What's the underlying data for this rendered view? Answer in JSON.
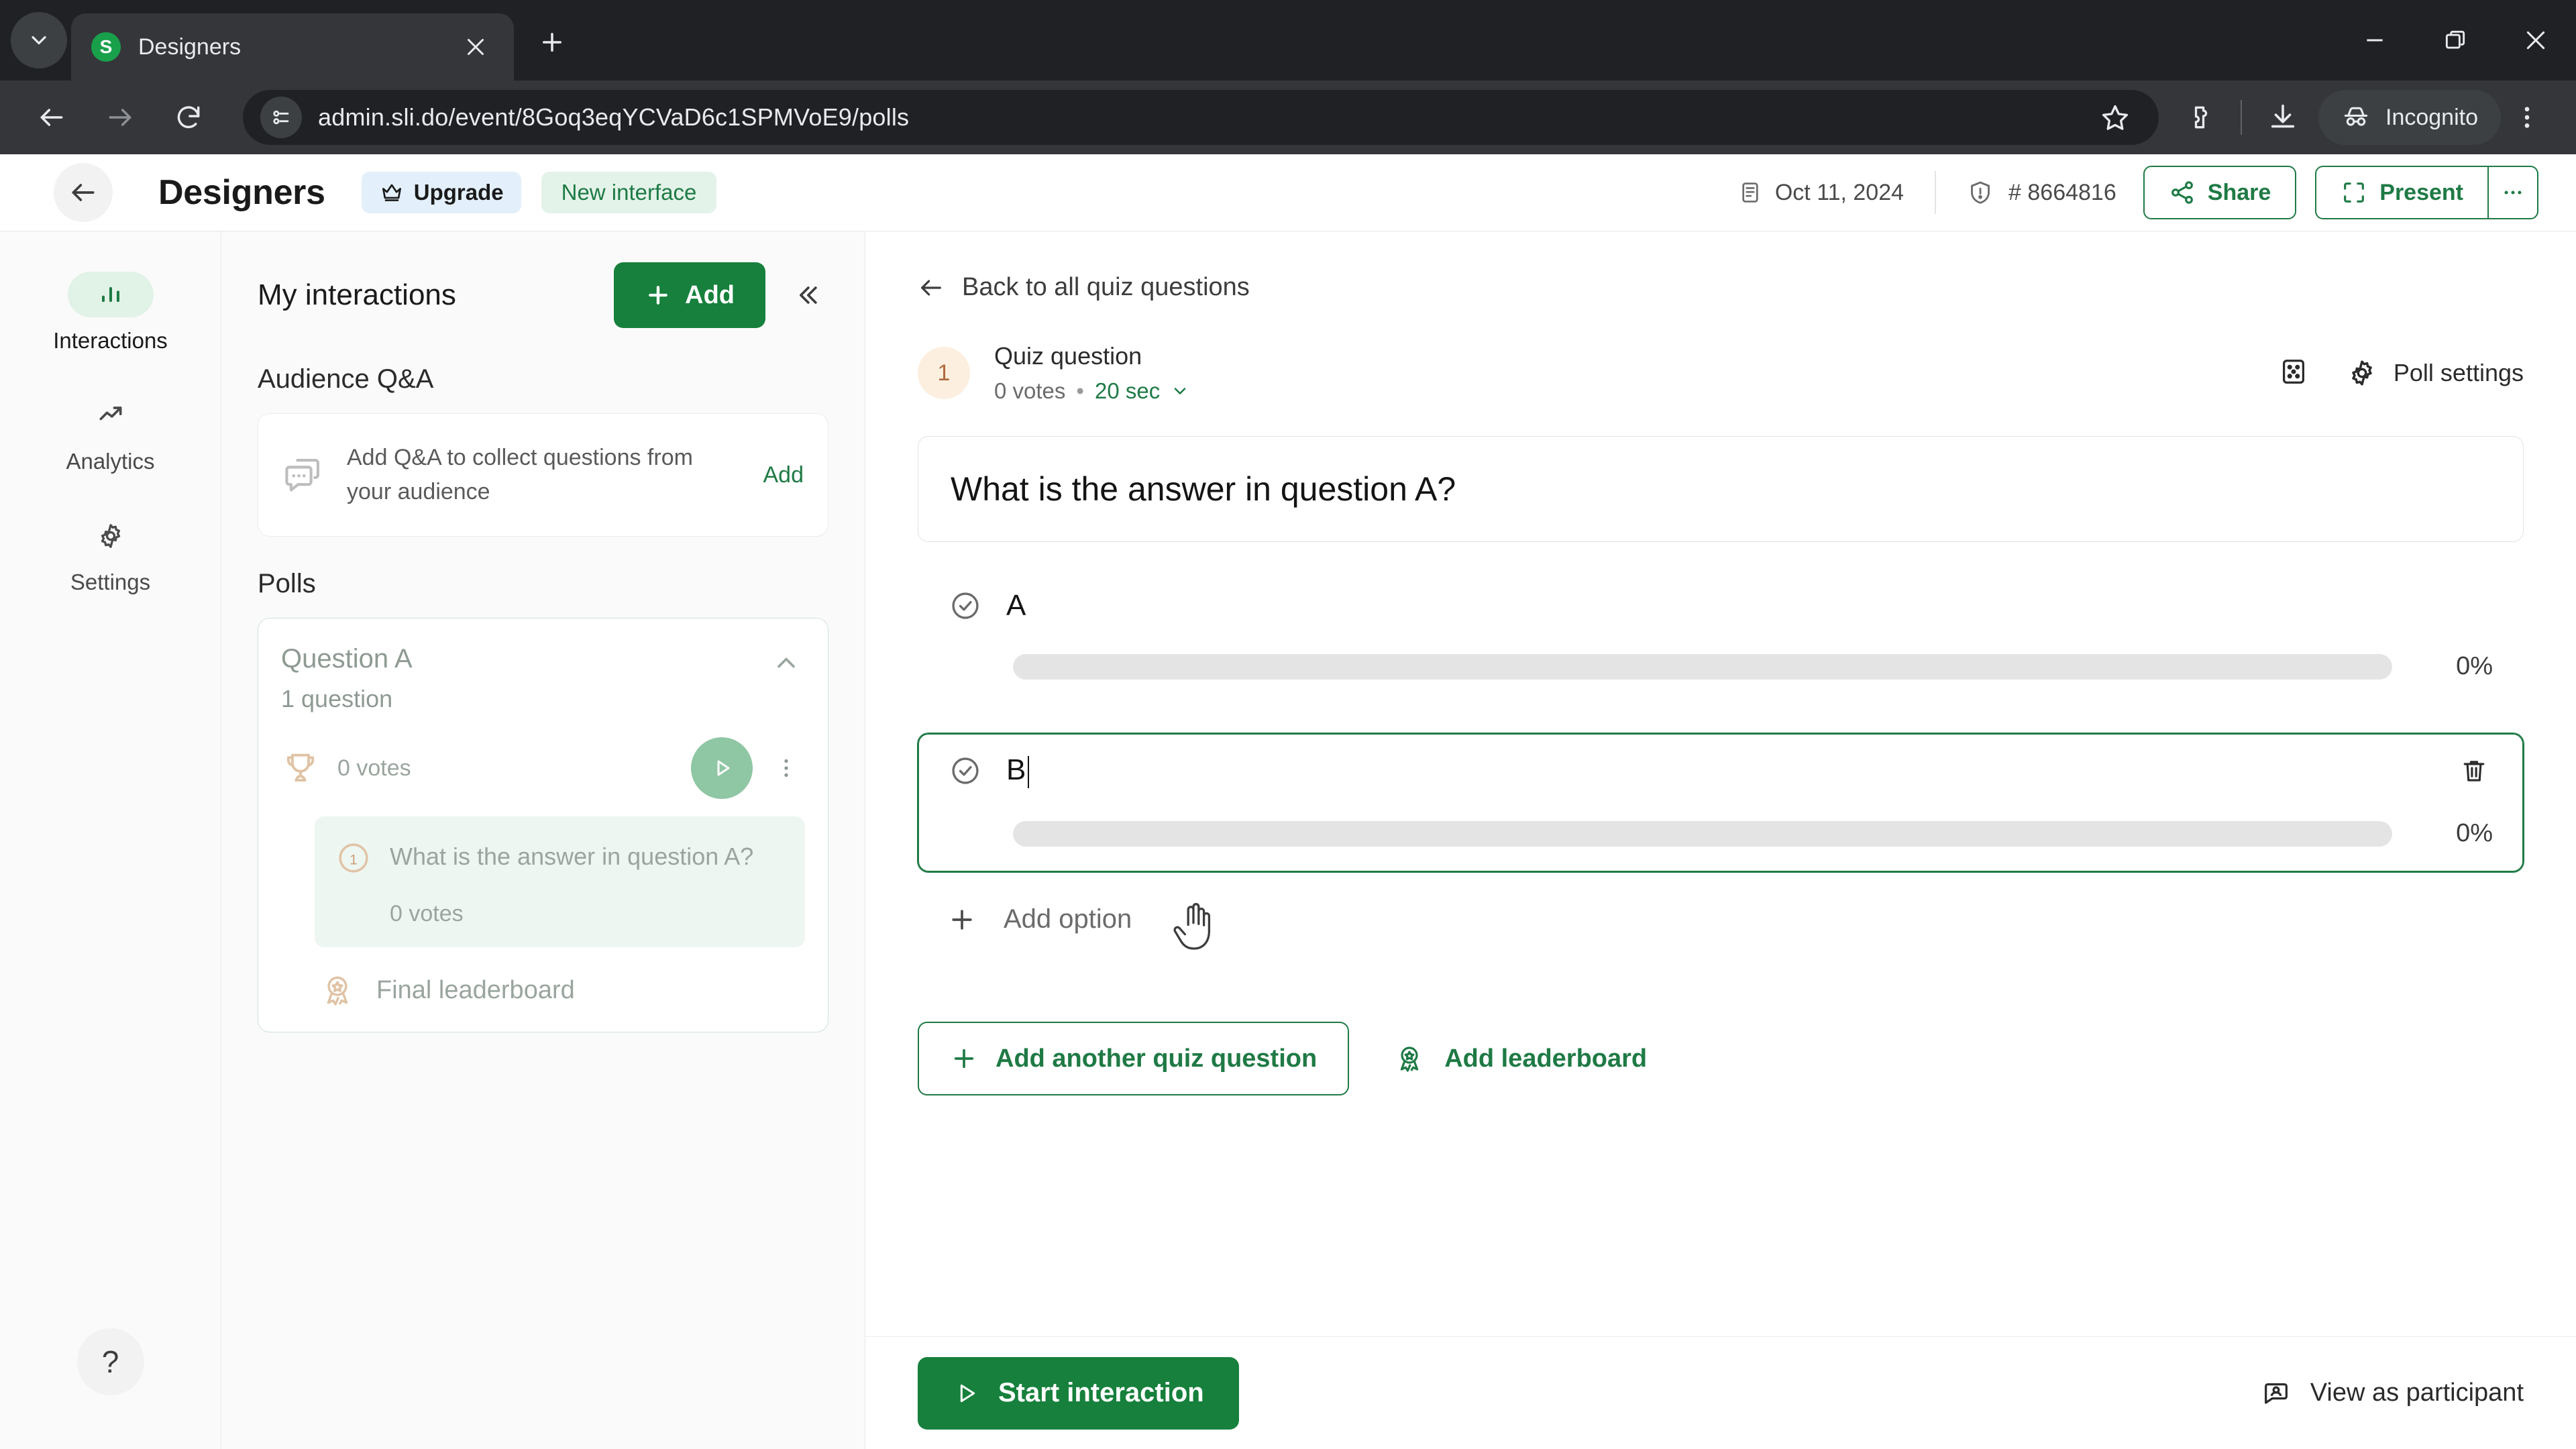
{
  "browser": {
    "tab": {
      "title": "Designers",
      "favicon_letter": "S"
    },
    "url": "admin.sli.do/event/8Goq3eqYCVaD6c1SPMVoE9/polls",
    "profile_label": "Incognito",
    "icons": {
      "tab_search": "chevron-down-icon",
      "close_tab": "close-icon",
      "new_tab": "plus-icon",
      "minimize": "minimize-icon",
      "maximize": "maximize-icon",
      "close_window": "close-icon",
      "back": "back-arrow-icon",
      "forward": "forward-arrow-icon",
      "reload": "reload-icon",
      "site_info": "site-settings-icon",
      "bookmark": "star-icon",
      "extensions": "extensions-icon",
      "downloads": "download-icon",
      "incognito": "incognito-icon",
      "menu": "three-dot-menu-icon"
    }
  },
  "header": {
    "back": "back-arrow-icon",
    "title": "Designers",
    "upgrade_label": "Upgrade",
    "new_interface_label": "New interface",
    "date": "Oct 11, 2024",
    "event_code": "# 8664816",
    "share_label": "Share",
    "present_label": "Present",
    "more_label": "···"
  },
  "rail": {
    "items": [
      {
        "label": "Interactions",
        "icon": "bar-chart-icon",
        "active": true
      },
      {
        "label": "Analytics",
        "icon": "trending-up-icon",
        "active": false
      },
      {
        "label": "Settings",
        "icon": "gear-icon",
        "active": false
      }
    ],
    "help_label": "?"
  },
  "panel": {
    "title": "My interactions",
    "add_label": "Add",
    "collapse_icon": "double-chevron-left-icon",
    "qa_section_title": "Audience Q&A",
    "qa_card": {
      "text": "Add Q&A to collect questions from your audience",
      "action_label": "Add",
      "icon": "chat-bubbles-icon"
    },
    "polls_section_title": "Polls",
    "poll_group": {
      "name": "Question A",
      "subtitle": "1 question",
      "votes": "0 votes",
      "trophy_icon": "trophy-icon",
      "play_icon": "play-icon",
      "kebab_icon": "three-dot-menu-icon",
      "chevron_icon": "chevron-up-icon",
      "question": {
        "number": "1",
        "text": "What is the answer in question A?",
        "votes": "0 votes"
      },
      "leaderboard_label": "Final leaderboard",
      "leaderboard_icon": "medal-icon"
    }
  },
  "main": {
    "back_link": "Back to all quiz questions",
    "question_number": "1",
    "question_kind": "Quiz question",
    "votes": "0 votes",
    "separator": "•",
    "duration": "20 sec",
    "duration_caret": "chevron-down-icon",
    "grid_icon": "dice-grid-icon",
    "poll_settings_label": "Poll settings",
    "poll_settings_icon": "gear-icon",
    "question_text": "What is the answer in question A?",
    "options": [
      {
        "label": "A",
        "percent": "0%",
        "focused": false,
        "check_icon": "check-circle-icon"
      },
      {
        "label": "B",
        "percent": "0%",
        "focused": true,
        "check_icon": "check-circle-icon",
        "delete_icon": "trash-icon"
      }
    ],
    "add_option_label": "Add option",
    "add_option_icon": "plus-icon",
    "add_question_label": "Add another quiz question",
    "add_leaderboard_label": "Add leaderboard",
    "add_leaderboard_icon": "medal-icon"
  },
  "footer": {
    "start_label": "Start interaction",
    "start_icon": "play-icon",
    "view_participant_label": "View as participant",
    "view_participant_icon": "participant-view-icon"
  },
  "colors": {
    "brand_green": "#16803c",
    "accent_green": "#1f7a45",
    "chrome_dark": "#202124",
    "chrome_toolbar": "#35363a"
  }
}
